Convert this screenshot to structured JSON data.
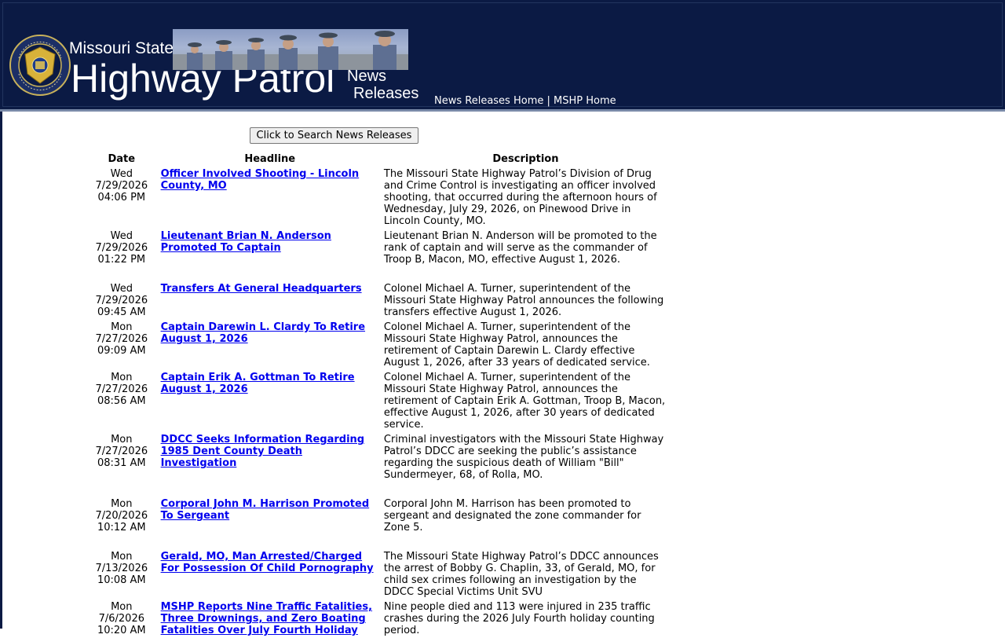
{
  "header": {
    "brand_top": "Missouri State",
    "brand_main": "Highway Patrol",
    "news_word": "News",
    "releases_word": "Releases",
    "seal_text": "MISSOURI STATE HIGHWAY PATROL",
    "links": [
      "News Releases Home",
      "MSHP Home"
    ],
    "link_separator": "|",
    "colors": {
      "background": "#0b1a44",
      "text": "#ffffff"
    }
  },
  "search_button_label": "Click to Search News Releases",
  "table": {
    "columns": [
      "Date",
      "Headline",
      "Description"
    ],
    "rows": [
      {
        "day": "Wed",
        "date": "7/29/2026",
        "time": "04:06 PM",
        "headline": "Officer Involved Shooting - Lincoln County, MO",
        "description": "The Missouri State Highway Patrol’s Division of Drug and Crime Control is investigating an officer involved shooting, that occurred during the afternoon hours of Wednesday, July 29, 2026, on Pinewood Drive in Lincoln County, MO."
      },
      {
        "day": "Wed",
        "date": "7/29/2026",
        "time": "01:22 PM",
        "headline": "Lieutenant Brian N. Anderson Promoted To Captain",
        "description": "Lieutenant Brian N. Anderson will be promoted to the rank of captain and will serve as the commander of Troop B, Macon, MO, effective August 1, 2026."
      },
      {
        "day": "Wed",
        "date": "7/29/2026",
        "time": "09:45 AM",
        "headline": "Transfers At General Headquarters",
        "description": "Colonel Michael A. Turner, superintendent of the Missouri State Highway Patrol announces the following transfers effective August 1, 2026."
      },
      {
        "day": "Mon",
        "date": "7/27/2026",
        "time": "09:09 AM",
        "headline": "Captain Darewin L. Clardy To Retire August 1, 2026",
        "description": "Colonel Michael A. Turner, superintendent of the Missouri State Highway Patrol, announces the retirement of Captain Darewin L. Clardy effective August 1, 2026, after 33 years of dedicated service."
      },
      {
        "day": "Mon",
        "date": "7/27/2026",
        "time": "08:56 AM",
        "headline": "Captain Erik A. Gottman To Retire August 1, 2026",
        "description": "Colonel Michael A. Turner, superintendent of the Missouri State Highway Patrol, announces the retirement of Captain Erik A. Gottman, Troop B, Macon, effective August 1, 2026, after 30 years of dedicated service."
      },
      {
        "day": "Mon",
        "date": "7/27/2026",
        "time": "08:31 AM",
        "headline": "DDCC Seeks Information Regarding 1985 Dent County Death Investigation",
        "description": "Criminal investigators with the Missouri State Highway Patrol’s DDCC are seeking the public’s assistance regarding the suspicious death of William \"Bill\" Sundermeyer, 68, of Rolla, MO."
      },
      {
        "day": "Mon",
        "date": "7/20/2026",
        "time": "10:12 AM",
        "headline": "Corporal John M. Harrison Promoted To Sergeant",
        "description": "Corporal John M. Harrison has been promoted to sergeant and designated the zone commander for Zone 5."
      },
      {
        "day": "Mon",
        "date": "7/13/2026",
        "time": "10:08 AM",
        "headline": "Gerald, MO, Man Arrested/Charged For Possession Of Child Pornography",
        "description": "The Missouri State Highway Patrol’s DDCC announces the arrest of Bobby G. Chaplin, 33, of Gerald, MO, for child sex crimes following an investigation by the DDCC Special Victims Unit SVU"
      },
      {
        "day": "Mon",
        "date": "7/6/2026",
        "time": "10:20 AM",
        "headline": "MSHP Reports Nine Traffic Fatalities, Three Drownings, and Zero Boating Fatalities Over July Fourth Holiday",
        "description": "Nine people died and 113 were injured in 235 traffic crashes during the 2026 July Fourth holiday counting period."
      }
    ]
  }
}
